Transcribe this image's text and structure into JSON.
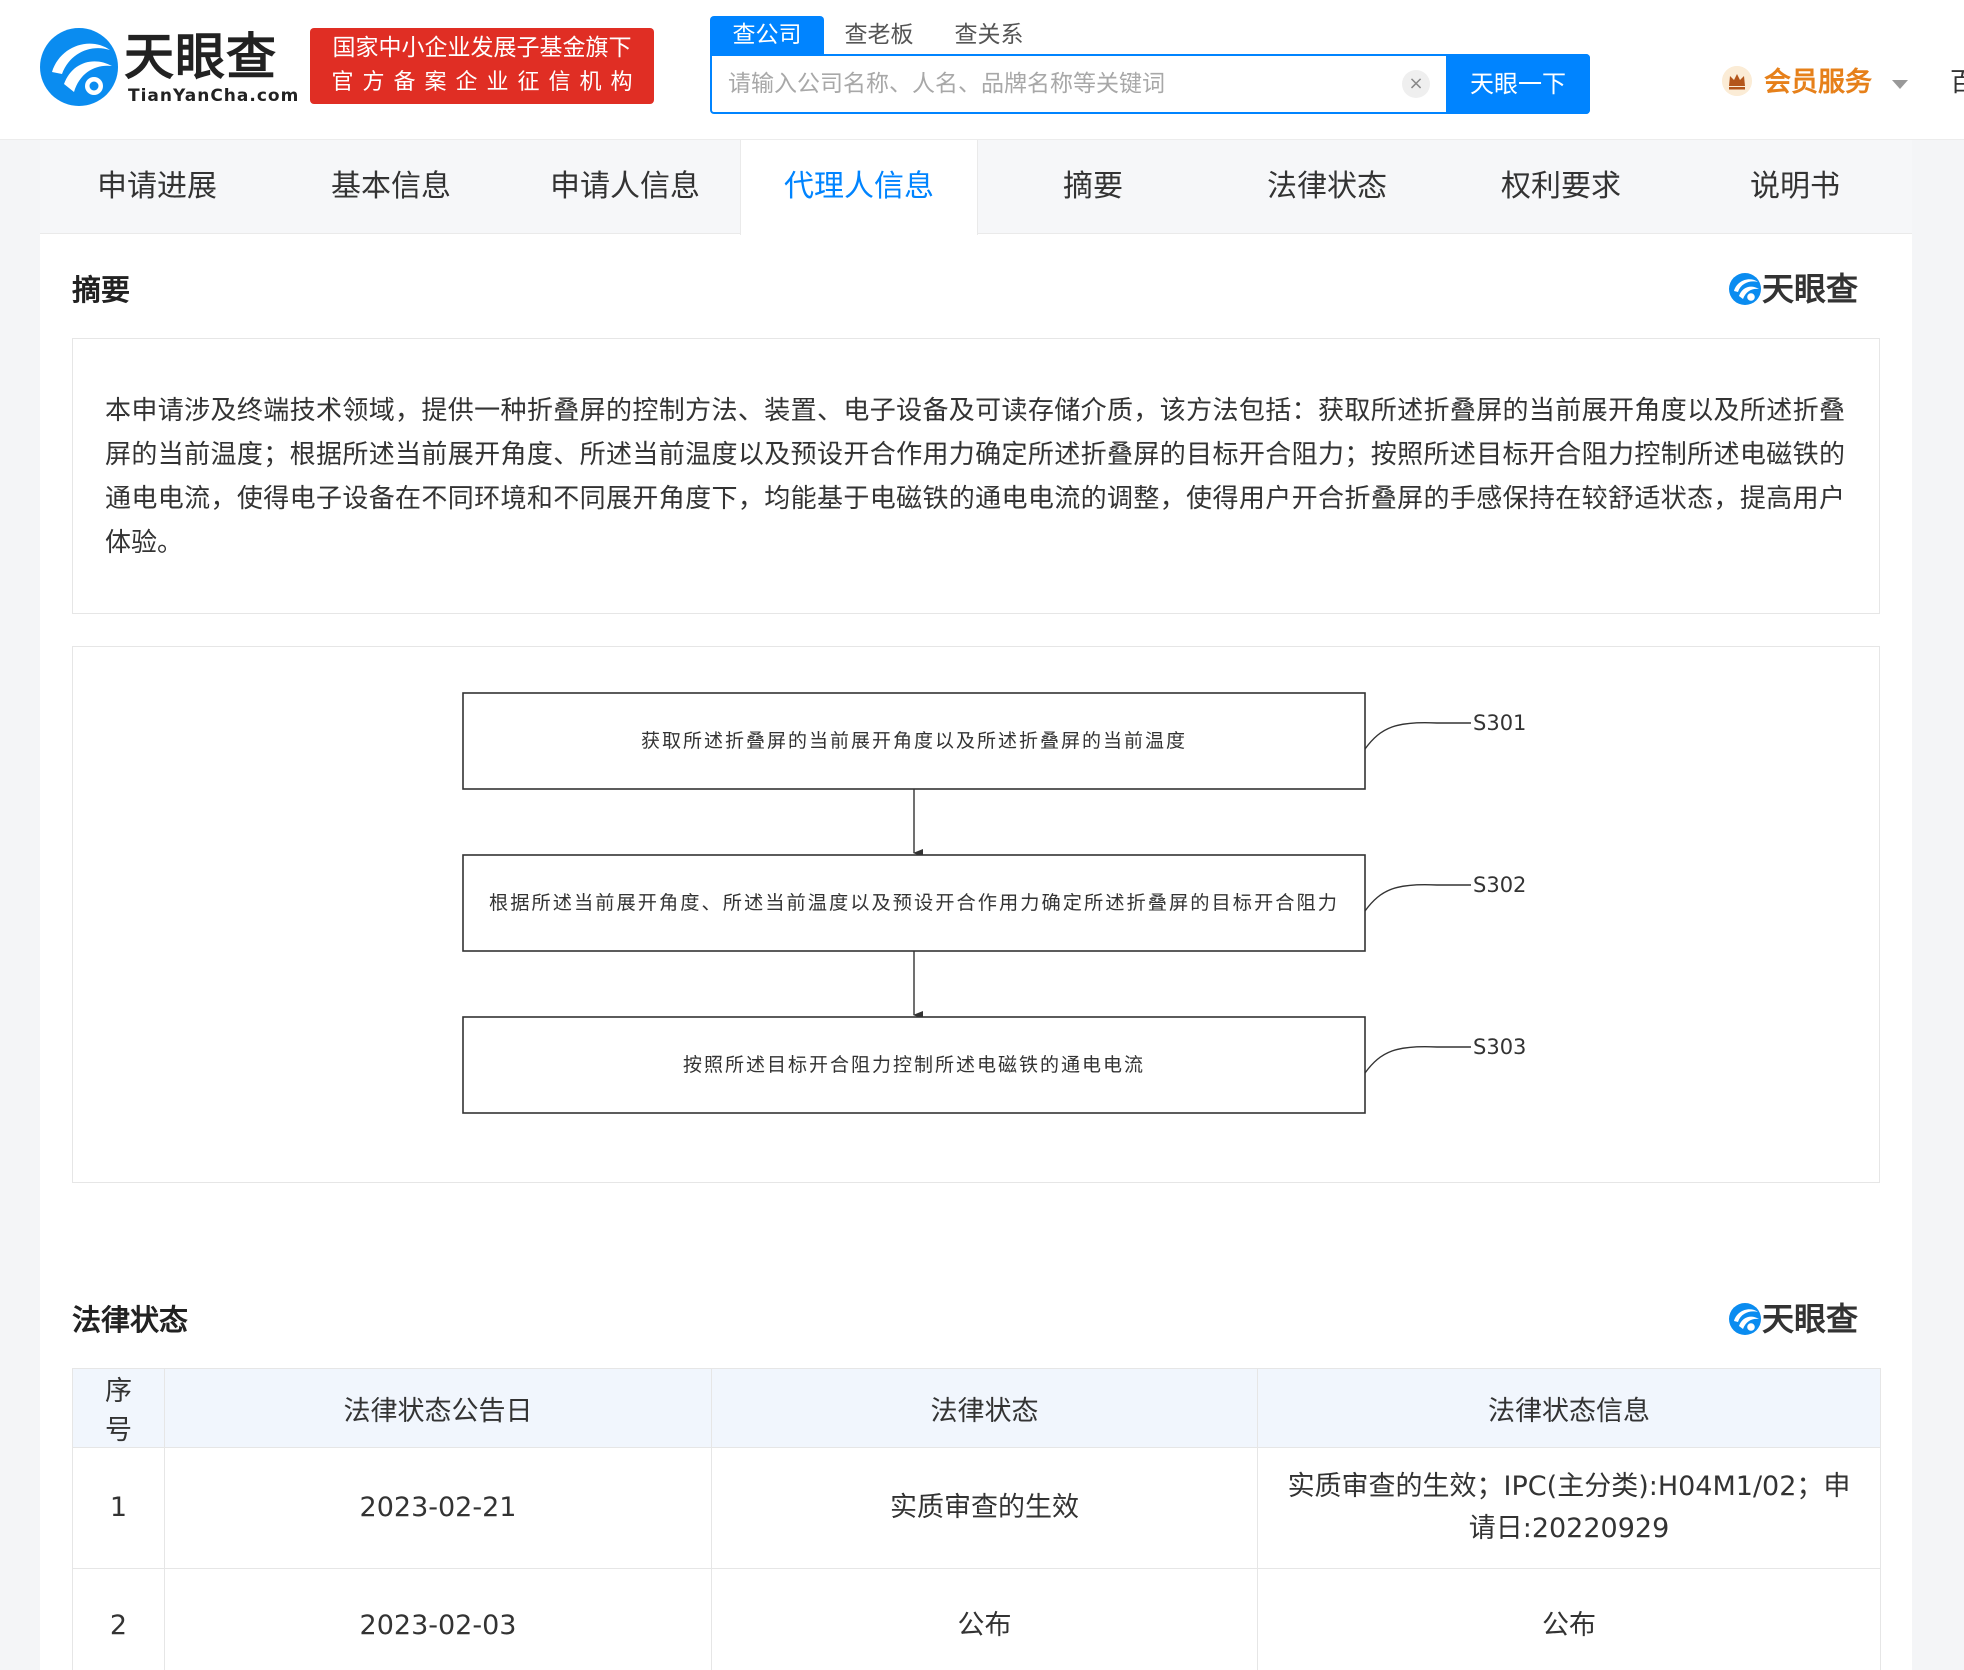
{
  "header": {
    "logo_name": "天眼查",
    "logo_domain": "TianYanCha.com",
    "gov_badge_line1": "国家中小企业发展子基金旗下",
    "gov_badge_line2": "官方备案企业征信机构",
    "search_tabs": [
      "查公司",
      "查老板",
      "查关系"
    ],
    "search_placeholder": "请输入公司名称、人名、品牌名称等关键词",
    "search_clear": "×",
    "search_button": "天眼一下",
    "vip_label": "会员服务",
    "edge_glyph": "百"
  },
  "nav_tabs": [
    "申请进展",
    "基本信息",
    "申请人信息",
    "代理人信息",
    "摘要",
    "法律状态",
    "权利要求",
    "说明书"
  ],
  "active_tab": "代理人信息",
  "abstract": {
    "title": "摘要",
    "watermark": "天眼查",
    "text": "本申请涉及终端技术领域，提供一种折叠屏的控制方法、装置、电子设备及可读存储介质，该方法包括：获取所述折叠屏的当前展开角度以及所述折叠屏的当前温度；根据所述当前展开角度、所述当前温度以及预设开合作用力确定所述折叠屏的目标开合阻力；按照所述目标开合阻力控制所述电磁铁的通电电流，使得电子设备在不同环境和不同展开角度下，均能基于电磁铁的通电电流的调整，使得用户开合折叠屏的手感保持在较舒适状态，提高用户体验。"
  },
  "flowchart": {
    "steps": [
      {
        "id": "S301",
        "text": "获取所述折叠屏的当前展开角度以及所述折叠屏的当前温度"
      },
      {
        "id": "S302",
        "text": "根据所述当前展开角度、所述当前温度以及预设开合作用力确定所述折叠屏的目标开合阻力"
      },
      {
        "id": "S303",
        "text": "按照所述目标开合阻力控制所述电磁铁的通电电流"
      }
    ]
  },
  "legal_status": {
    "title": "法律状态",
    "watermark": "天眼查",
    "columns": [
      "序号",
      "法律状态公告日",
      "法律状态",
      "法律状态信息"
    ],
    "rows": [
      {
        "no": "1",
        "date": "2023-02-21",
        "status": "实质审查的生效",
        "info": "实质审查的生效；IPC(主分类):H04M1/02；申请日:20220929"
      },
      {
        "no": "2",
        "date": "2023-02-03",
        "status": "公布",
        "info": "公布"
      }
    ]
  },
  "colors": {
    "brand_blue": "#0084ff",
    "badge_red": "#e02e24",
    "vip_orange": "#e6801a"
  }
}
